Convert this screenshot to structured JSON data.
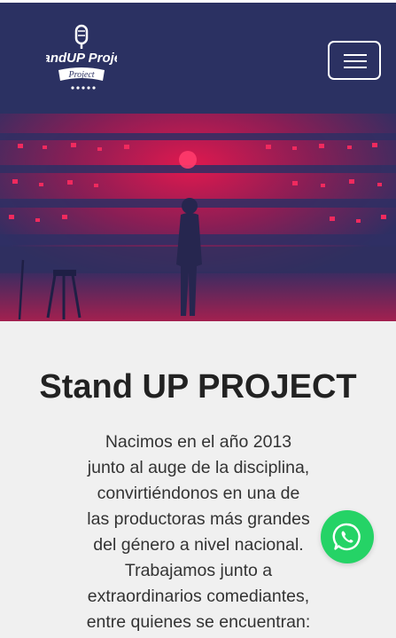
{
  "header": {
    "logo_text": "StandUP Project",
    "menu_icon": "hamburger-menu-icon"
  },
  "hero": {
    "image": "theater-stage-photo"
  },
  "main": {
    "title": "Stand UP PROJECT",
    "description_lines": [
      "Nacimos en el año 2013",
      "junto al auge de la disciplina,",
      "convirtiéndonos en una de",
      "las productoras más grandes",
      "del género a nivel nacional.",
      "Trabajamos junto a",
      "extraordinarios comediantes,",
      "entre quienes se encuentran:"
    ]
  },
  "floating": {
    "whatsapp_icon": "whatsapp-icon"
  },
  "colors": {
    "navbar": "#2b3162",
    "hero_tint": "#2e2f63",
    "hero_red": "#d8154a",
    "page_bg": "#f0f0f0",
    "whatsapp": "#25d366"
  }
}
